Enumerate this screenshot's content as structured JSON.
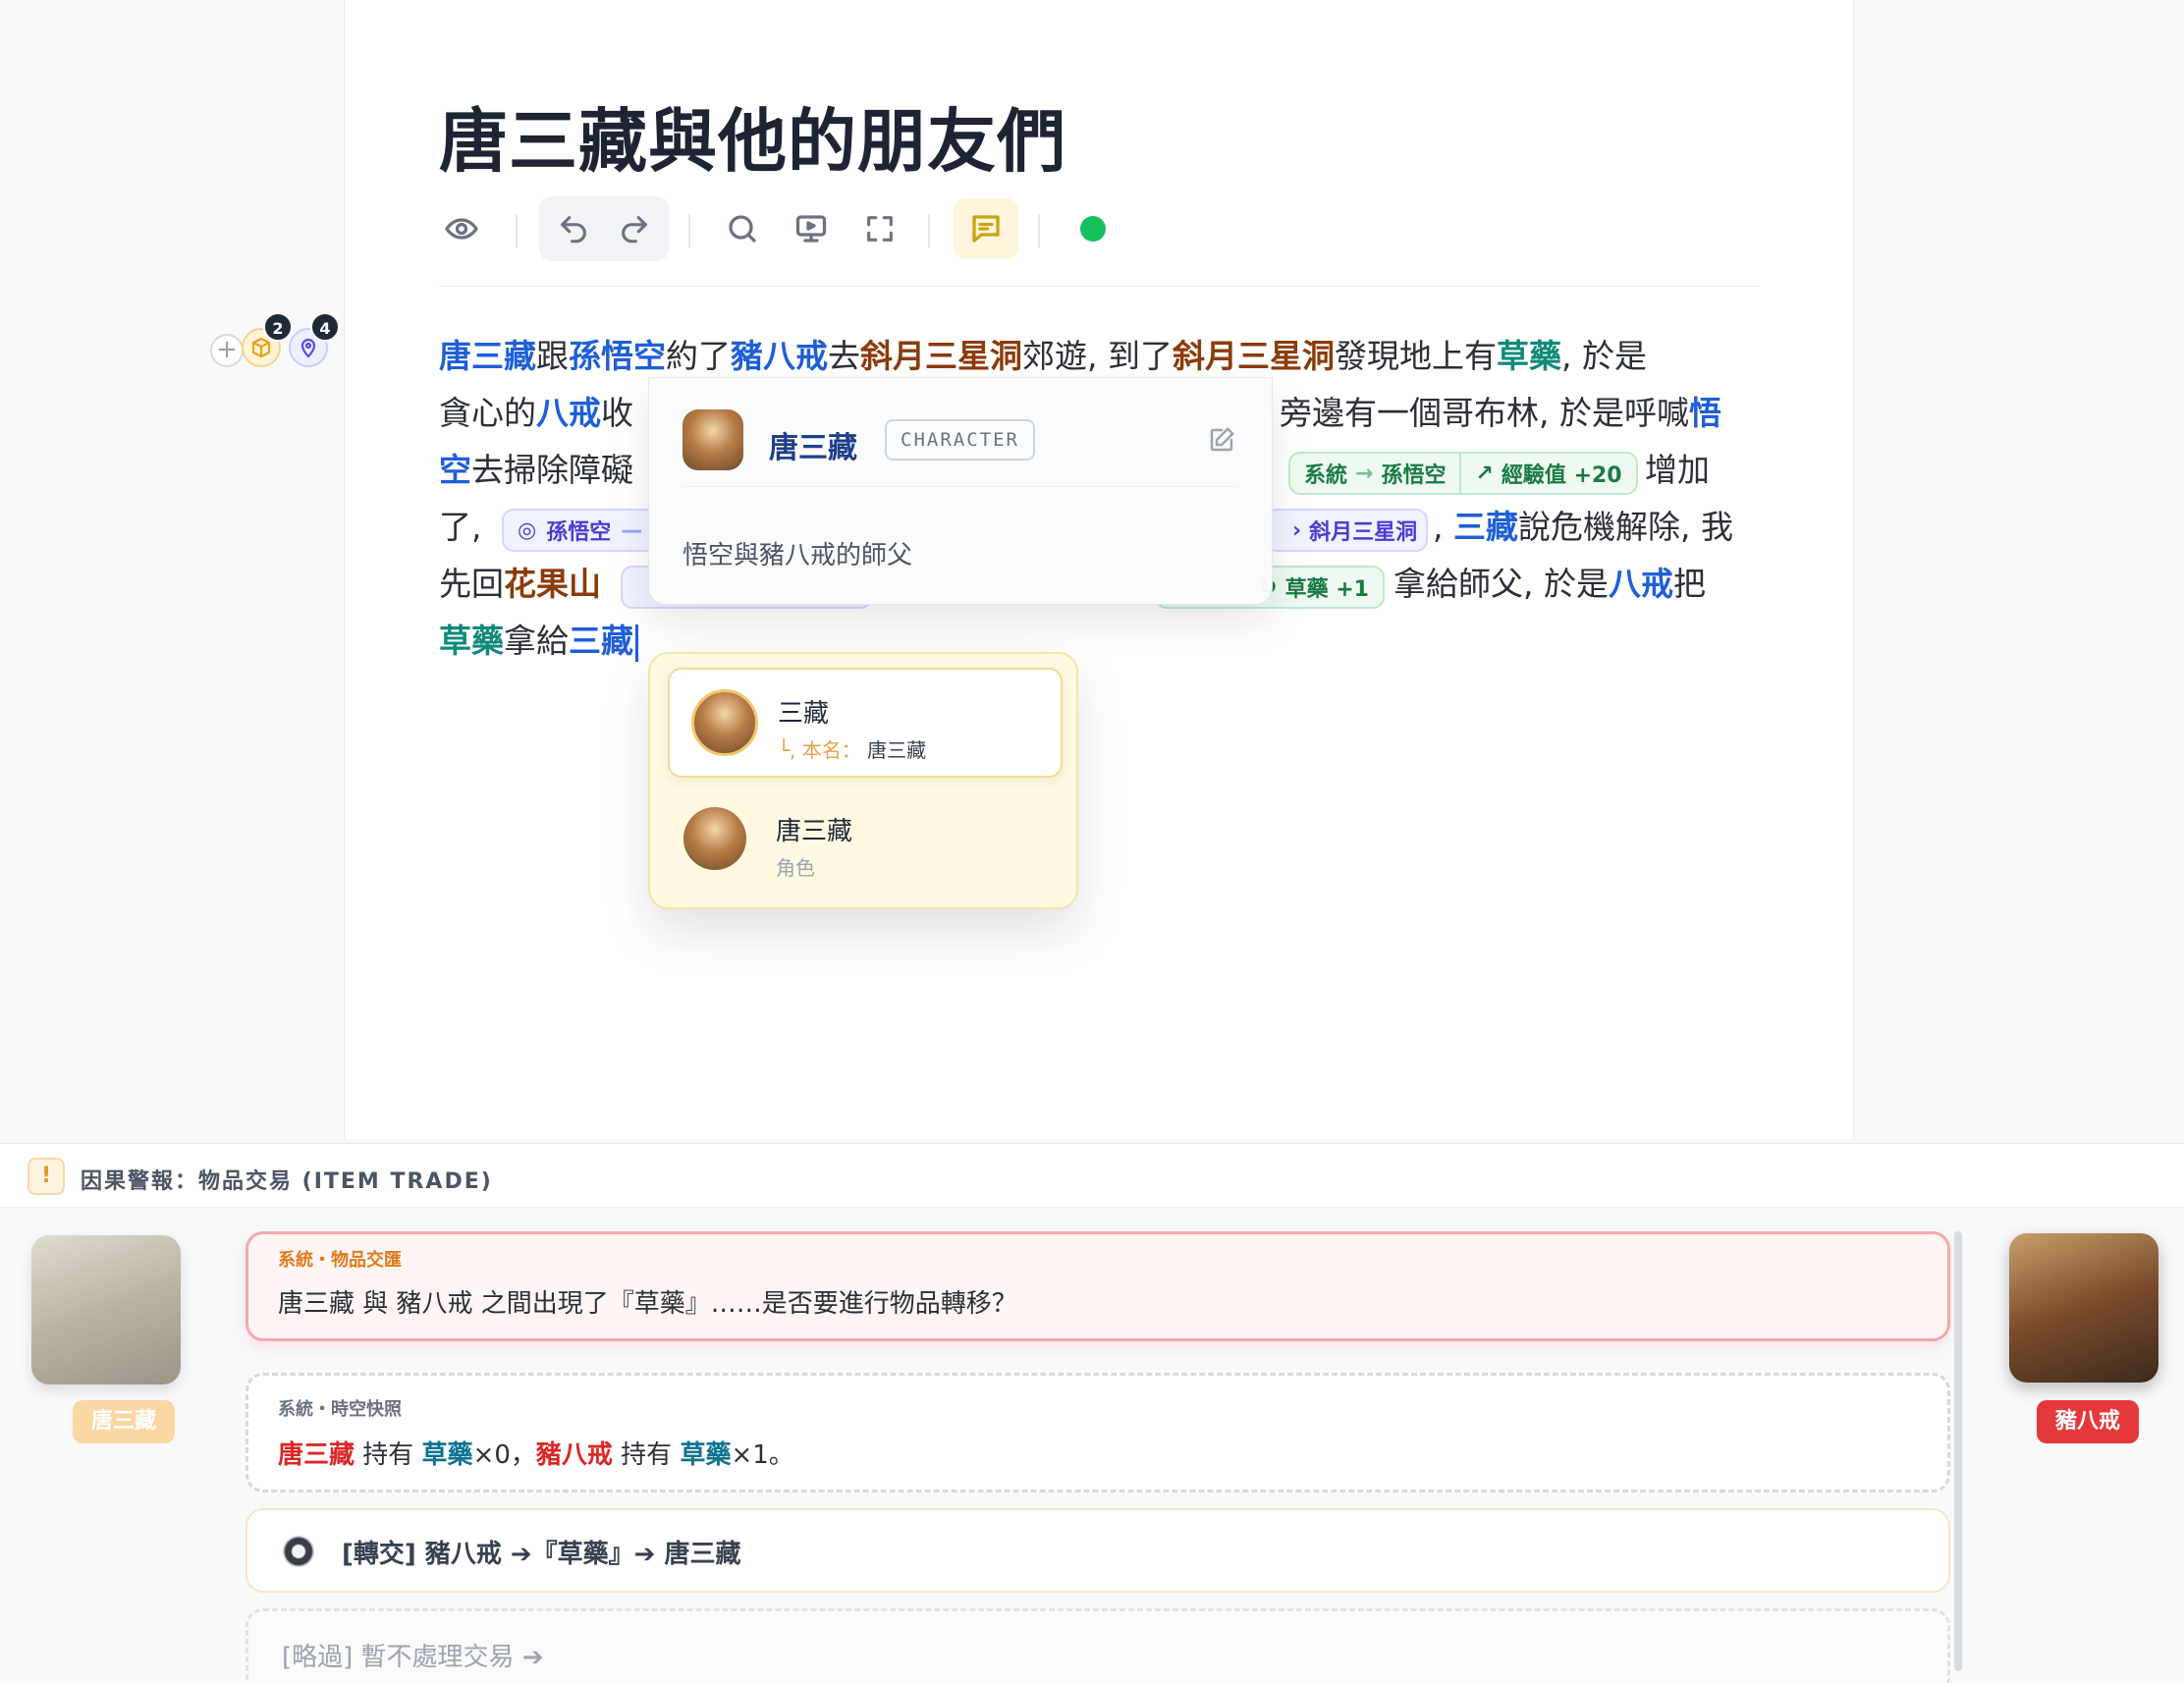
{
  "document": {
    "title": "唐三藏與他的朋友們"
  },
  "toolbar": {
    "preview": "eye-icon",
    "undo": "undo-icon",
    "redo": "redo-icon",
    "search": "search-icon",
    "present": "monitor-play-icon",
    "fullscreen": "fullscreen-icon",
    "comment": "comment-icon",
    "status_color": "#16c15b"
  },
  "gutter": {
    "add": "+",
    "item_count": "2",
    "location_count": "4"
  },
  "body": {
    "l1": {
      "a": "唐三藏",
      "b": "跟",
      "c": "孫悟空",
      "d": "約了",
      "e": "豬八戒",
      "f": "去",
      "g": "斜月三星洞",
      "h": "郊遊, 到了",
      "i": "斜月三星洞",
      "j": "發現地上有",
      "k": "草藥",
      "l": ", 於是"
    },
    "l2": {
      "a": "貪心的",
      "b": "八戒",
      "c": "收",
      "d": "旁邊有一個哥布林, 於是呼喊",
      "e": "悟"
    },
    "l3": {
      "a": "空",
      "b": "去掃除障礙",
      "c": "增加"
    },
    "l4": {
      "a": "了,",
      "b": ",",
      "c": "三藏",
      "d": "說危機解除, 我"
    },
    "l5": {
      "a": "先回",
      "b": "花果山",
      "c": "拿給師父, 於是",
      "d": "八戒",
      "e": "把"
    },
    "l6": {
      "a": "草藥",
      "b": "拿給",
      "c": "三藏"
    }
  },
  "chips": {
    "system": "系統",
    "system_target": "孫悟空",
    "exp": "經驗值 +20",
    "loc1": "孫悟空",
    "loc2": "斜月三星洞",
    "item": "草藥 +1"
  },
  "popover": {
    "name": "唐三藏",
    "tag": "CHARACTER",
    "description": "悟空與豬八戒的師父"
  },
  "suggestions": [
    {
      "name": "三藏",
      "sub_label": "本名：",
      "sub_value": "唐三藏"
    },
    {
      "name": "唐三藏",
      "sub": "角色"
    }
  ],
  "alert": {
    "title": "因果警報：物品交易 (ITEM TRADE)"
  },
  "trade": {
    "left_name": "唐三藏",
    "right_name": "豬八戒",
    "alert_tag": "系統・物品交匯",
    "alert_text": "唐三藏 與 豬八戒 之間出現了『草藥』……是否要進行物品轉移？",
    "snap_tag": "系統・時空快照",
    "snap": {
      "c1": "唐三藏",
      "t1": " 持有 ",
      "i1": "草藥",
      "q1": "×0，",
      "c2": "豬八戒",
      "t2": " 持有 ",
      "i2": "草藥",
      "q2": "×1。"
    },
    "option_transfer": "[轉交] 豬八戒 ➔『草藥』➔ 唐三藏",
    "option_skip": "[略過] 暫不處理交易 ➔"
  }
}
